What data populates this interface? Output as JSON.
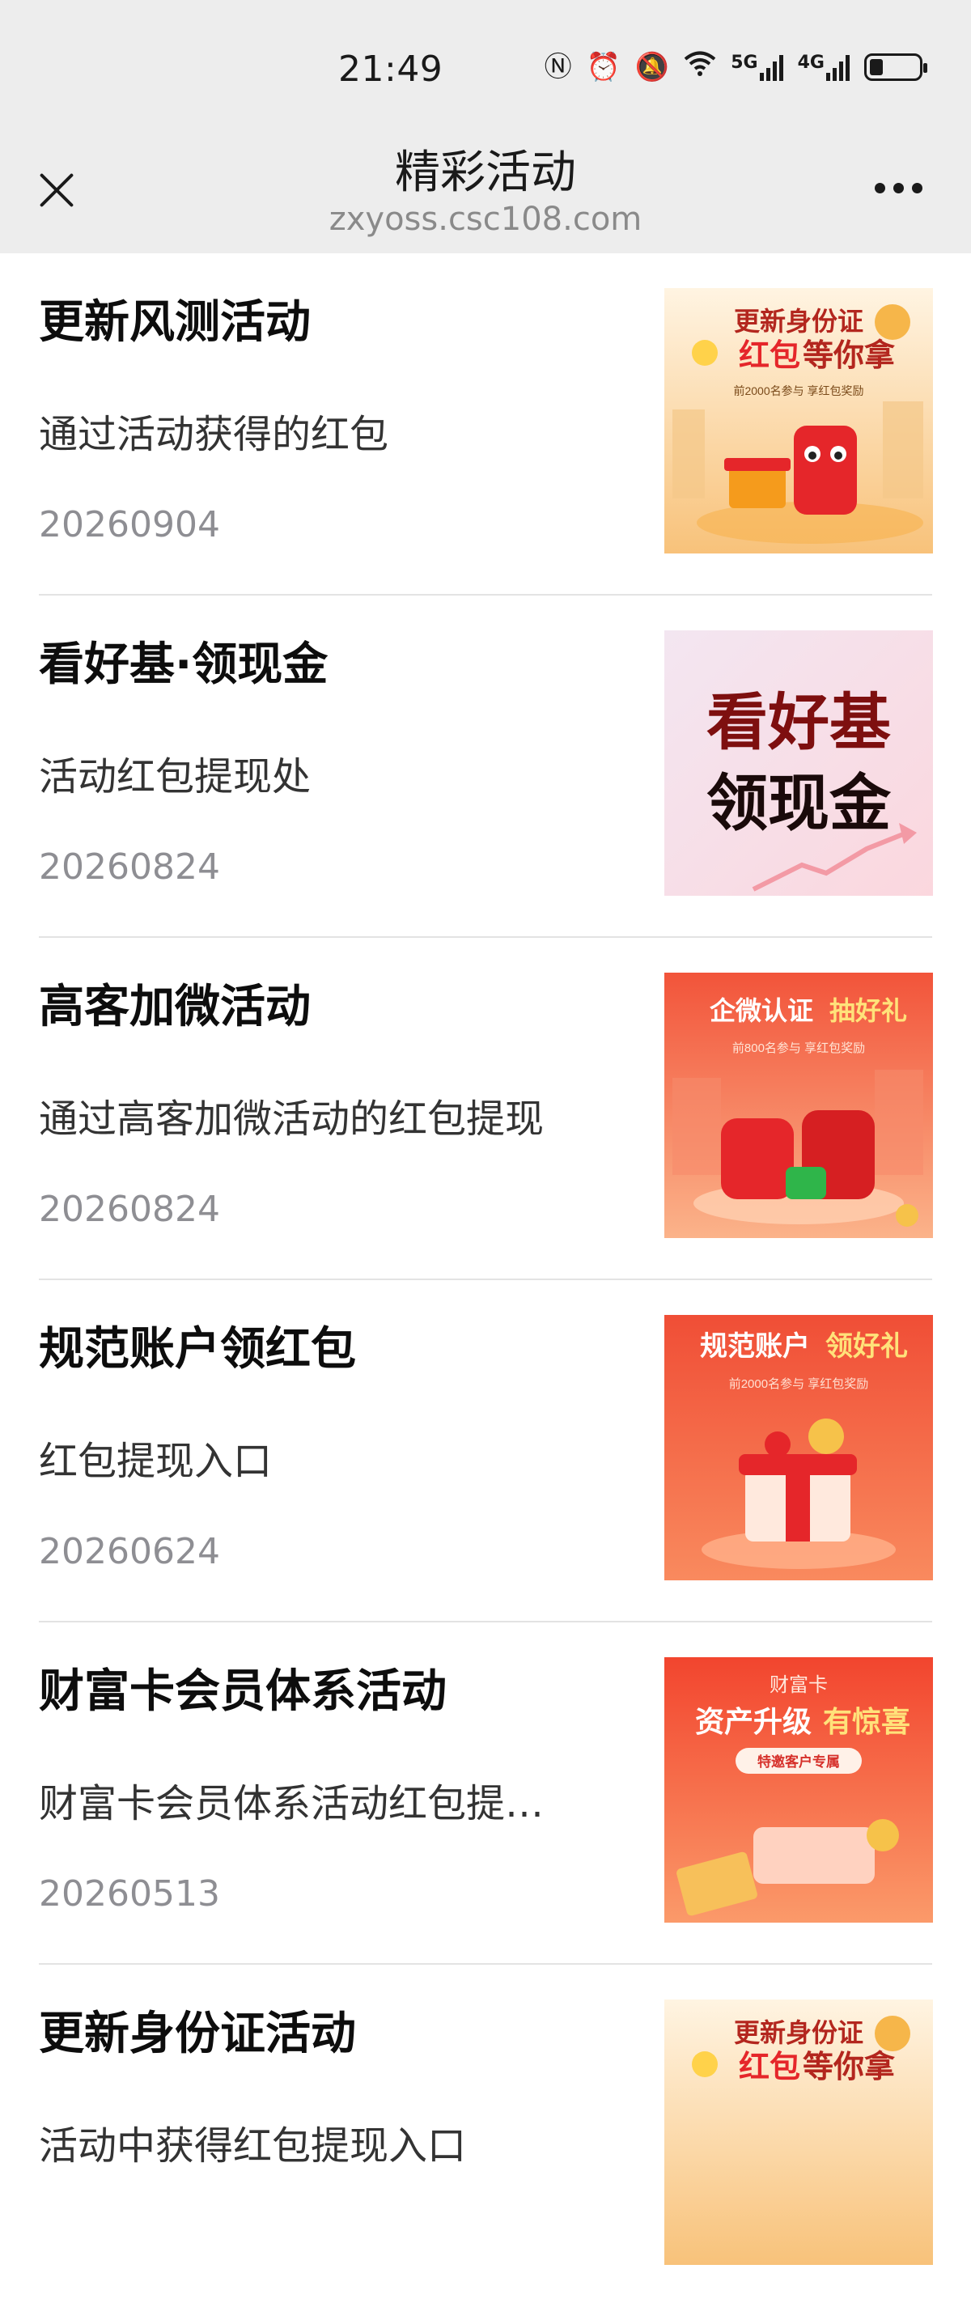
{
  "status_bar": {
    "time": "21:49",
    "net1": "5G",
    "net2": "4G"
  },
  "nav": {
    "title": "精彩活动",
    "url": "zxyoss.csc108.com"
  },
  "items": [
    {
      "title": "更新风测活动",
      "desc": "通过活动获得的红包",
      "date": "20260904",
      "banner": {
        "line1": "更新身份证",
        "line2a": "红包",
        "line2b": "等你拿",
        "sub": "前2000名参与  享红包奖励"
      }
    },
    {
      "title": "看好基·领现金",
      "desc": "活动红包提现处",
      "date": "20260824",
      "banner": {
        "line1": "看好基",
        "line2": "领现金"
      }
    },
    {
      "title": "高客加微活动",
      "desc": "通过高客加微活动的红包提现",
      "date": "20260824",
      "banner": {
        "line1a": "企微认证",
        "line1b": "抽好礼",
        "sub": "前800名参与  享红包奖励"
      }
    },
    {
      "title": "规范账户领红包",
      "desc": "红包提现入口",
      "date": "20260624",
      "banner": {
        "line1a": "规范账户",
        "line1b": "领好礼",
        "sub": "前2000名参与  享红包奖励"
      }
    },
    {
      "title": "财富卡会员体系活动",
      "desc": "财富卡会员体系活动红包提…",
      "date": "20260513",
      "banner": {
        "top": "财富卡",
        "line1a": "资产升级",
        "line1b": "有惊喜",
        "tag": "特邀客户专属"
      }
    },
    {
      "title": "更新身份证活动",
      "desc": "活动中获得红包提现入口",
      "date": "",
      "banner": {
        "line1": "更新身份证",
        "line2a": "红包",
        "line2b": "等你拿"
      }
    }
  ]
}
